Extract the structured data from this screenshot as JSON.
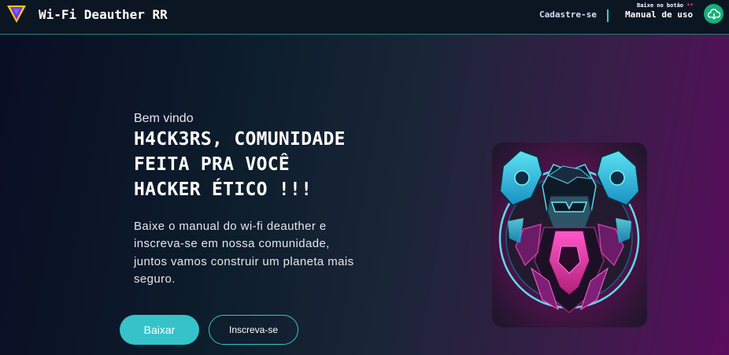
{
  "header": {
    "brand": "Wi-Fi Deauther RR",
    "nav_signup": "Cadastre-se",
    "nav_manual": "Manual de uso",
    "download_hint": "Baixe no botão",
    "download_hint_marks": "**"
  },
  "hero": {
    "greeting": "Bem vindo",
    "headline_lines": [
      "H4CK3RS, COMUNIDADE",
      "FEITA PRA VOCÊ",
      "HACKER ÉTICO !!!"
    ],
    "description_lines": [
      "Baixe o manual do wi-fi deauther e",
      "inscreva-se em nossa comunidade,",
      "juntos vamos construir um planeta mais",
      "seguro."
    ],
    "primary_button": "Baixar",
    "secondary_button": "Inscreva-se"
  },
  "icons": {
    "logo": "triangle-logo-icon",
    "download": "cloud-download-icon",
    "hero": "cyber-hacker-mask-illustration"
  },
  "colors": {
    "accent": "#35c2c8",
    "download_button": "#14b07a",
    "hint_marks": "#e2475a",
    "page_start": "#0a0d24",
    "page_end": "#5a0c5e"
  }
}
